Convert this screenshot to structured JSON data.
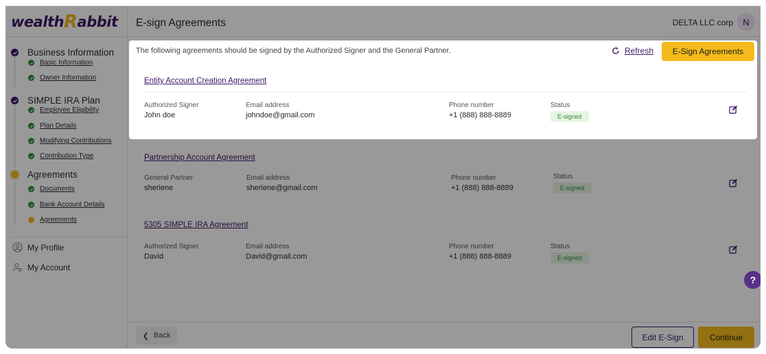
{
  "brand": {
    "logo_text_1": "wealth",
    "logo_r": "R",
    "logo_text_2": "abbit",
    "accent": "#f0b61f",
    "primary": "#3c1a63"
  },
  "sidebar": {
    "sections": [
      {
        "label": "Business Information",
        "status": "done",
        "items": [
          {
            "label": "Basic Information",
            "status": "done"
          },
          {
            "label": "Owner Information",
            "status": "done"
          }
        ]
      },
      {
        "label": "SIMPLE IRA Plan",
        "status": "done",
        "items": [
          {
            "label": "Employee Eligibility",
            "status": "done"
          },
          {
            "label": "Plan Details",
            "status": "done"
          },
          {
            "label": "Modifying Contributions",
            "status": "done"
          },
          {
            "label": "Contribution Type",
            "status": "done"
          }
        ]
      },
      {
        "label": "Agreements",
        "status": "current",
        "items": [
          {
            "label": "Documents",
            "status": "done"
          },
          {
            "label": "Bank Account Details",
            "status": "done"
          },
          {
            "label": "Agreements",
            "status": "current"
          }
        ]
      }
    ],
    "links": [
      {
        "label": "My Profile",
        "icon": "user-icon"
      },
      {
        "label": "My Account",
        "icon": "user-settings-icon"
      }
    ]
  },
  "header": {
    "title": "E-sign Agreements",
    "company": "DELTA LLC corp",
    "avatar_initial": "N"
  },
  "topbar": {
    "notice": "The following agreements should be signed by the Authorized Signer and the General Partner.",
    "refresh_label": "Refresh",
    "esign_button": "E-Sign Agreements"
  },
  "agreements": [
    {
      "title": "Entity Account Creation Agreement",
      "role_label": "Authorized Signer",
      "role_value": "John doe",
      "email_label": "Email address",
      "email": "johndoe@gmail.com",
      "phone_label": "Phone number",
      "phone": "+1 (888) 888-8889",
      "status_label": "Status",
      "status": "E-signed"
    },
    {
      "title": "Partnership Account Agreement",
      "role_label": "General Partner",
      "role_value": "sheriene",
      "email_label": "Email address",
      "email": "sheriene@gmail.com",
      "phone_label": "Phone number",
      "phone": "+1 (888) 888-8889",
      "status_label": "Status",
      "status": "E-signed"
    },
    {
      "title": "5305 SIMPLE IRA Agreement",
      "role_label": "Authorized Signer",
      "role_value": "David",
      "email_label": "Email address",
      "email": "David@gmail.com",
      "phone_label": "Phone number",
      "phone": "+1 (888) 888-8889",
      "status_label": "Status",
      "status": "E-signed"
    }
  ],
  "footer": {
    "back_label": "Back",
    "edit_esign_label": "Edit E-Sign",
    "continue_label": "Continue"
  },
  "help": {
    "label": "?",
    "icon": "help-icon"
  }
}
